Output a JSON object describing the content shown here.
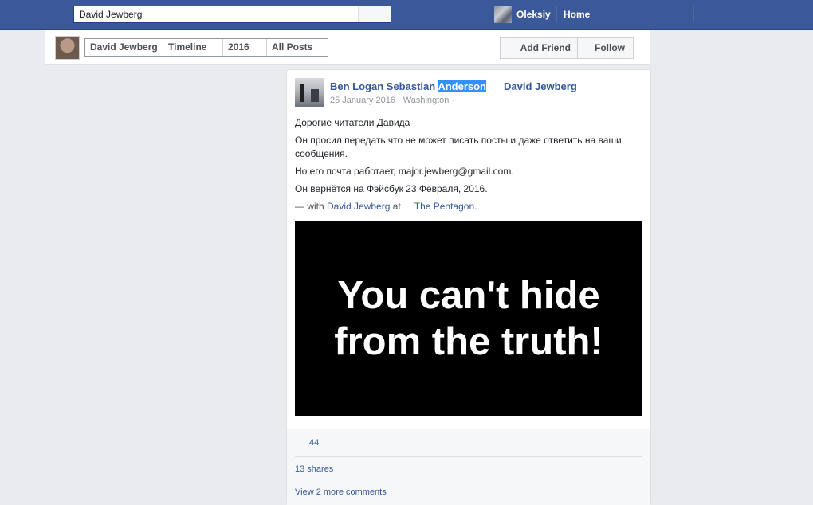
{
  "topbar": {
    "search_value": "David Jewberg",
    "user_name": "Oleksiy",
    "home_label": "Home"
  },
  "profile_header": {
    "breadcrumbs": [
      "David Jewberg",
      "Timeline",
      "2016",
      "All Posts"
    ],
    "add_friend_label": "Add Friend",
    "follow_label": "Follow"
  },
  "post": {
    "author_prefix": "Ben Logan Sebastian ",
    "author_highlight": "Anderson",
    "tagged": "David Jewberg",
    "date": "25 January 2016",
    "location": "Washington",
    "meta_sep": " · ",
    "lines": [
      "Дорогие читатели Давида",
      "Он просил передать что не может писать посты и даже ответить на ваши сообщения.",
      "Но его почта работает, major.jewberg@gmail.com.",
      "Он вернётся на Фэйсбук 23 Февраля, 2016."
    ],
    "with_prefix": "— with ",
    "with_person": "David Jewberg",
    "at_word": " at",
    "place": "The Pentagon.",
    "image_text_line1": "You can't hide",
    "image_text_line2": "from the truth!",
    "likes": "44",
    "shares": "13 shares",
    "more_comments": "View 2 more comments"
  }
}
